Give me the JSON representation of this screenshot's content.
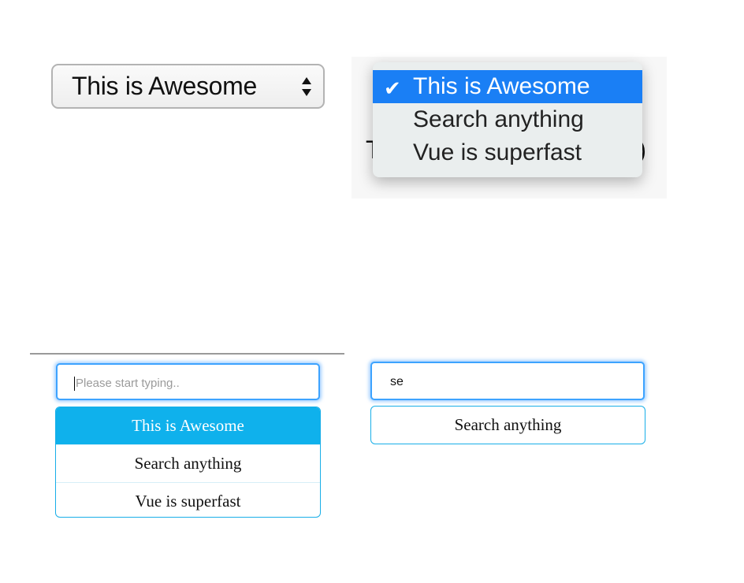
{
  "native_select_closed": {
    "value": "This is Awesome",
    "arrows_icon": "updown-chevrons-icon"
  },
  "native_select_open": {
    "behind_left": "T",
    "behind_right": ")",
    "check_icon": "checkmark-icon",
    "options": [
      {
        "label": "This is Awesome",
        "selected": true
      },
      {
        "label": "Search anything",
        "selected": false
      },
      {
        "label": "Vue is superfast",
        "selected": false
      }
    ]
  },
  "autocomplete_left": {
    "placeholder": "Please start typing..",
    "value": "",
    "suggestions": [
      "This is Awesome",
      "Search anything",
      "Vue is superfast"
    ],
    "active_index": 0
  },
  "autocomplete_right": {
    "value": "se",
    "suggestions": [
      "Search anything"
    ]
  },
  "colors": {
    "native_highlight": "#1a7ff5",
    "autocomplete_active": "#0fb1ec",
    "autocomplete_border": "#18aee8",
    "focus_ring": "#3da3ff"
  }
}
